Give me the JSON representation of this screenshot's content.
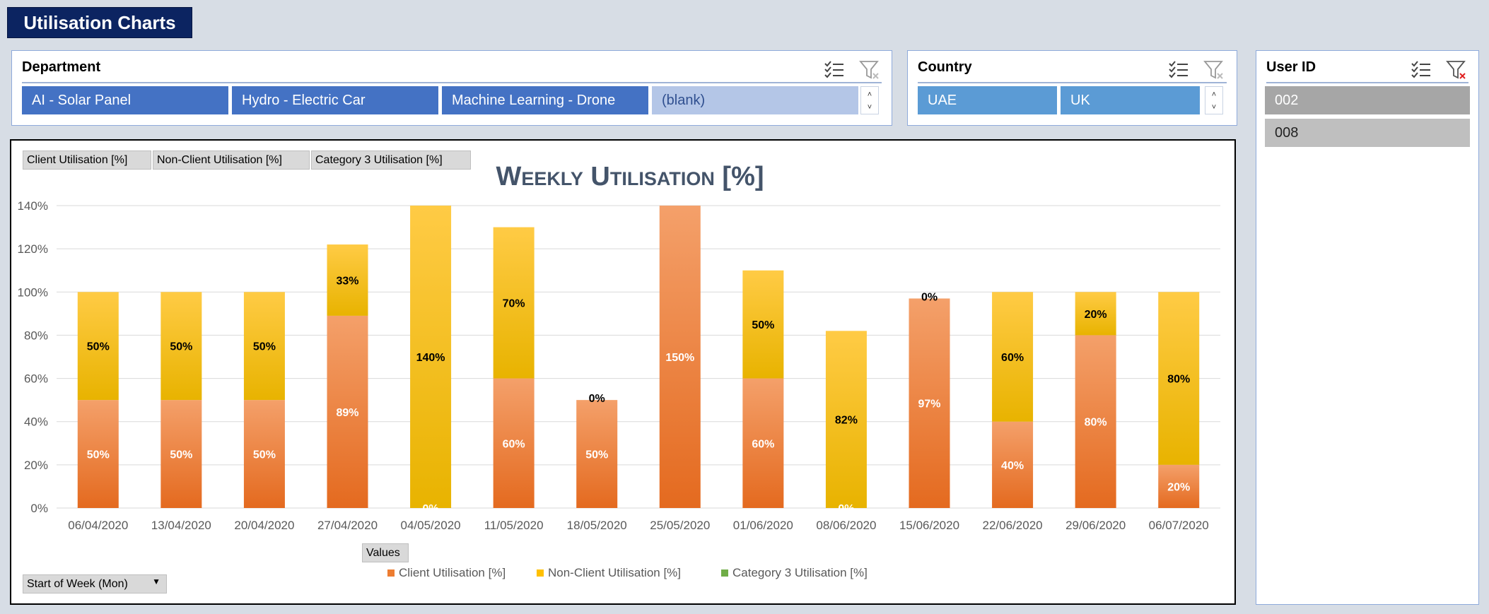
{
  "page_title": "Utilisation Charts",
  "department": {
    "header": "Department",
    "items": [
      "AI - Solar Panel",
      "Hydro - Electric Car",
      "Machine Learning - Drone",
      "(blank)"
    ]
  },
  "country": {
    "header": "Country",
    "items": [
      "UAE",
      "UK"
    ]
  },
  "user": {
    "header": "User ID",
    "items": [
      "002",
      "008"
    ]
  },
  "field_buttons": {
    "series": [
      "Client Utilisation [%]",
      "Non-Client Utilisation [%]",
      "Category 3 Utilisation [%]"
    ],
    "values": "Values",
    "axis": "Start of Week (Mon)"
  },
  "chart_data": {
    "type": "bar",
    "stacked": true,
    "title": "Weekly Utilisation [%]",
    "xlabel": "",
    "ylabel": "",
    "ylim": [
      0,
      140
    ],
    "yticks": [
      "0%",
      "20%",
      "40%",
      "60%",
      "80%",
      "100%",
      "120%",
      "140%"
    ],
    "grid": true,
    "legend": "bottom",
    "categories": [
      "06/04/2020",
      "13/04/2020",
      "20/04/2020",
      "27/04/2020",
      "04/05/2020",
      "11/05/2020",
      "18/05/2020",
      "25/05/2020",
      "01/06/2020",
      "08/06/2020",
      "15/06/2020",
      "22/06/2020",
      "29/06/2020",
      "06/07/2020"
    ],
    "series": [
      {
        "name": "Client Utilisation [%]",
        "color": "#ed7d31",
        "values": [
          50,
          50,
          50,
          89,
          0,
          60,
          50,
          150,
          60,
          0,
          97,
          40,
          80,
          20
        ],
        "labels": [
          "50%",
          "50%",
          "50%",
          "89%",
          "0%",
          "60%",
          "50%",
          "150%",
          "60%",
          "0%",
          "97%",
          "40%",
          "80%",
          "20%"
        ]
      },
      {
        "name": "Non-Client Utilisation [%]",
        "color": "#ffc000",
        "values": [
          50,
          50,
          50,
          33,
          140,
          70,
          0,
          0,
          50,
          82,
          0,
          60,
          20,
          80
        ],
        "labels": [
          "50%",
          "50%",
          "50%",
          "33%",
          "140%",
          "70%",
          "0%",
          "",
          "50%",
          "82%",
          "0%",
          "60%",
          "20%",
          "80%"
        ]
      },
      {
        "name": "Category 3 Utilisation [%]",
        "color": "#70ad47",
        "values": [
          0,
          0,
          0,
          0,
          0,
          0,
          0,
          0,
          0,
          0,
          0,
          0,
          0,
          0
        ],
        "labels": []
      }
    ]
  }
}
